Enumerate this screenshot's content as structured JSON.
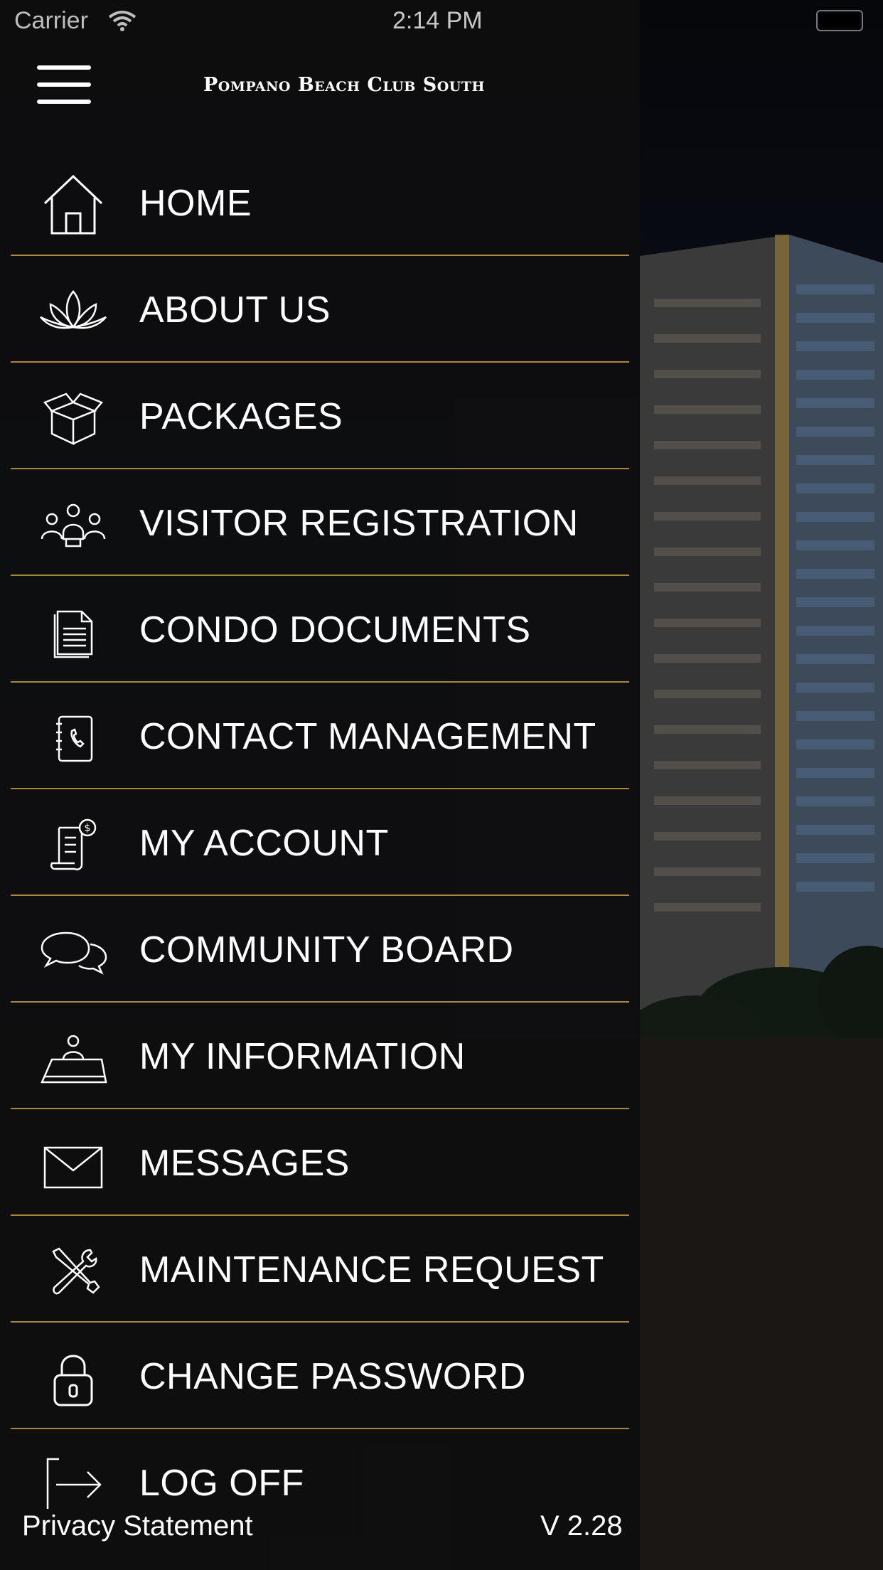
{
  "status_bar": {
    "carrier": "Carrier",
    "time": "2:14 PM"
  },
  "header": {
    "title": "Pompano Beach Club South",
    "menu_icon": "hamburger-icon"
  },
  "menu": {
    "items": [
      {
        "label": "HOME",
        "icon": "home-icon"
      },
      {
        "label": "ABOUT US",
        "icon": "lotus-icon"
      },
      {
        "label": "PACKAGES",
        "icon": "package-box-icon"
      },
      {
        "label": "VISITOR REGISTRATION",
        "icon": "people-group-icon"
      },
      {
        "label": "CONDO DOCUMENTS",
        "icon": "document-icon"
      },
      {
        "label": "CONTACT MANAGEMENT",
        "icon": "address-book-icon"
      },
      {
        "label": "MY ACCOUNT",
        "icon": "bill-dollar-icon"
      },
      {
        "label": "COMMUNITY BOARD",
        "icon": "chat-bubbles-icon"
      },
      {
        "label": "MY INFORMATION",
        "icon": "user-desk-icon"
      },
      {
        "label": "MESSAGES",
        "icon": "envelope-icon"
      },
      {
        "label": "MAINTENANCE REQUEST",
        "icon": "tools-icon"
      },
      {
        "label": "CHANGE PASSWORD",
        "icon": "padlock-icon"
      },
      {
        "label": "LOG OFF",
        "icon": "logout-arrow-icon"
      }
    ]
  },
  "footer": {
    "privacy_label": "Privacy Statement",
    "version": "V 2.28"
  },
  "colors": {
    "divider": "#a5893e",
    "drawer_bg": "#0e0e0f",
    "text": "#ffffff"
  }
}
